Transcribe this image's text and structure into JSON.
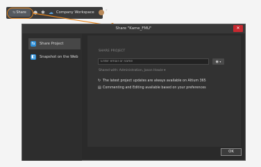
{
  "toolbar": {
    "share_label": "Share",
    "workspace_label": "Company Workspace"
  },
  "dialog": {
    "title": "Share \"Kame_FMU\"",
    "close_label": "✕",
    "sidebar": {
      "items": [
        {
          "label": "Share Project"
        },
        {
          "label": "Snapshot on the Web"
        }
      ]
    },
    "main": {
      "section_label": "SHARE PROJECT",
      "email_placeholder": "Enter email or name",
      "shared_with": "Shared with: Administration, Jason Howie ▾",
      "info_lines": [
        "The latest project updates are always available on Altium 365",
        "Commenting and Editing available based on your preferences"
      ]
    },
    "ok_label": "OK"
  },
  "colors": {
    "accent_orange": "#e8871e",
    "close_red": "#c8282f",
    "icon_blue": "#2d8fd8"
  }
}
